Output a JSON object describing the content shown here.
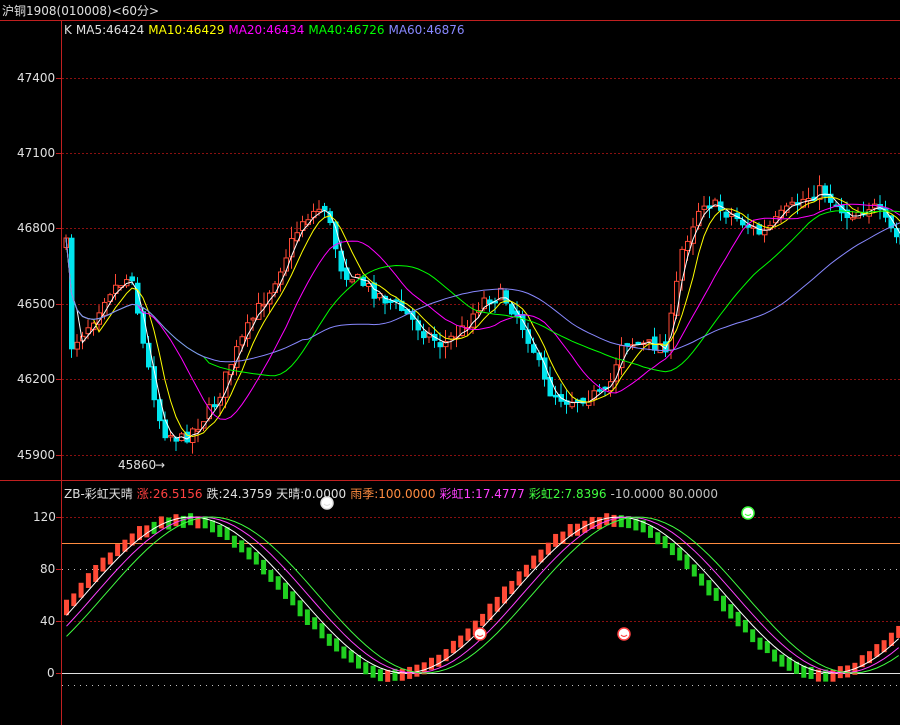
{
  "window": {
    "title": "沪铜1908(010008)<60分>"
  },
  "top_panel": {
    "legend": [
      {
        "text": "K",
        "color": "#e0e0e0"
      },
      {
        "text": "MA5:46424",
        "color": "#e0e0e0"
      },
      {
        "text": "MA10:46429",
        "color": "#ffff00"
      },
      {
        "text": "MA20:46434",
        "color": "#ff00ff"
      },
      {
        "text": "MA40:46726",
        "color": "#00ff00"
      },
      {
        "text": "MA60:46876",
        "color": "#8888ff"
      }
    ],
    "y_ticks": [
      "47400",
      "47100",
      "46800",
      "46500",
      "46200",
      "45900"
    ],
    "low_label": "45860"
  },
  "bottom_panel": {
    "legend": [
      {
        "text": "ZB-彩虹天晴",
        "color": "#e0e0e0"
      },
      {
        "text": "涨:26.5156",
        "color": "#ff4040"
      },
      {
        "text": "跌:24.3759",
        "color": "#e0e0e0"
      },
      {
        "text": "天晴:0.0000",
        "color": "#e0e0e0"
      },
      {
        "text": "雨季:100.0000",
        "color": "#ff8c40"
      },
      {
        "text": "彩虹1:17.4777",
        "color": "#ff40ff"
      },
      {
        "text": "彩虹2:7.8396",
        "color": "#40ff40"
      },
      {
        "text": "-10.0000",
        "color": "#c0c0c0"
      },
      {
        "text": "80.0000",
        "color": "#c0c0c0"
      }
    ],
    "y_ticks": [
      "120",
      "80",
      "40",
      "0"
    ]
  },
  "colors": {
    "up": "#ff4a36",
    "down": "#00e5ee",
    "grid": "#8a1010",
    "axis": "#c02020",
    "ma5": "#ffffff",
    "ma10": "#ffff00",
    "ma20": "#ff00ff",
    "ma40": "#00ff00",
    "ma60": "#8888ff"
  }
}
